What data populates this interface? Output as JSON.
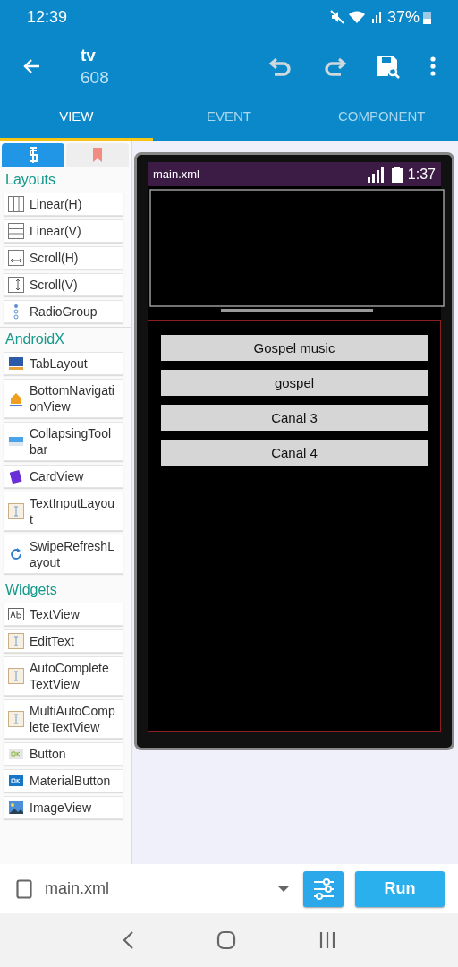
{
  "status_bar": {
    "time": "12:39",
    "battery": "37%"
  },
  "app_bar": {
    "title": "tv",
    "subtitle": "608"
  },
  "tabs": [
    {
      "label": "VIEW",
      "selected": true
    },
    {
      "label": "EVENT",
      "selected": false
    },
    {
      "label": "COMPONENT",
      "selected": false
    }
  ],
  "palette": {
    "tabs": [
      {
        "kind": "widgets",
        "selected": true
      },
      {
        "kind": "bookmarks",
        "selected": false
      }
    ],
    "sections": [
      {
        "title": "Layouts",
        "items": [
          {
            "label": "Linear(H)",
            "kind": "linear_h"
          },
          {
            "label": "Linear(V)",
            "kind": "linear_v"
          },
          {
            "label": "Scroll(H)",
            "kind": "scroll_h"
          },
          {
            "label": "Scroll(V)",
            "kind": "scroll_v"
          },
          {
            "label": "RadioGroup",
            "kind": "radio"
          }
        ]
      },
      {
        "title": "AndroidX",
        "items": [
          {
            "label": "TabLayout",
            "kind": "tab"
          },
          {
            "label": "BottomNavigationView",
            "kind": "bottomnav"
          },
          {
            "label": "CollapsingToolbar",
            "kind": "collapsing"
          },
          {
            "label": "CardView",
            "kind": "card"
          },
          {
            "label": "TextInputLayout",
            "kind": "textinput"
          },
          {
            "label": "SwipeRefreshLayout",
            "kind": "refresh"
          }
        ]
      },
      {
        "title": "Widgets",
        "items": [
          {
            "label": "TextView",
            "kind": "textview"
          },
          {
            "label": "EditText",
            "kind": "edittext"
          },
          {
            "label": "AutoCompleteTextView",
            "kind": "edittext"
          },
          {
            "label": "MultiAutoCompleteTextView",
            "kind": "edittext"
          },
          {
            "label": "Button",
            "kind": "button"
          },
          {
            "label": "MaterialButton",
            "kind": "materialbutton"
          },
          {
            "label": "ImageView",
            "kind": "imageview"
          }
        ]
      }
    ]
  },
  "preview": {
    "file": "main.xml",
    "time": "1:37",
    "buttons": [
      "Gospel music",
      "gospel",
      "Canal 3",
      "Canal 4"
    ]
  },
  "bottom_bar": {
    "file": "main.xml",
    "run": "Run"
  }
}
